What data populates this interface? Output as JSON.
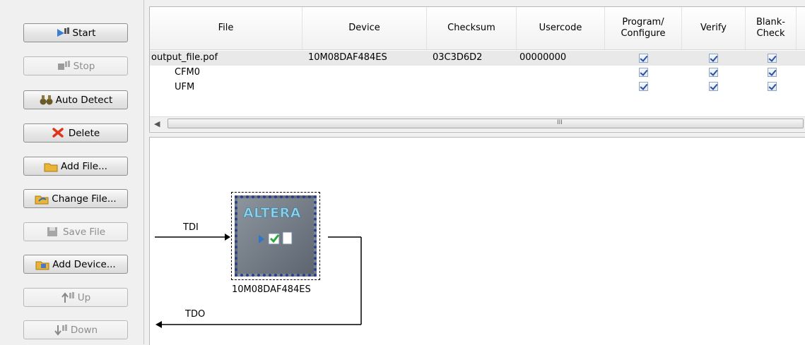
{
  "buttons": {
    "start": "Start",
    "stop": "Stop",
    "auto_detect": "Auto Detect",
    "delete": "Delete",
    "add_file": "Add File...",
    "change_file": "Change File...",
    "save_file": "Save File",
    "add_device": "Add Device...",
    "up": "Up",
    "down": "Down"
  },
  "table": {
    "headers": {
      "file": "File",
      "device": "Device",
      "checksum": "Checksum",
      "usercode": "Usercode",
      "program_line1": "Program/",
      "program_line2": "Configure",
      "verify": "Verify",
      "blank_line1": "Blank-",
      "blank_line2": "Check"
    },
    "rows": [
      {
        "file": "output_file.pof",
        "device": "10M08DAF484ES",
        "checksum": "03C3D6D2",
        "usercode": "00000000",
        "program": true,
        "verify": true,
        "blank_check": true
      },
      {
        "file": "CFM0",
        "device": "",
        "checksum": "",
        "usercode": "",
        "program": true,
        "verify": true,
        "blank_check": true
      },
      {
        "file": "UFM",
        "device": "",
        "checksum": "",
        "usercode": "",
        "program": true,
        "verify": true,
        "blank_check": true
      }
    ],
    "scroll_grip": "III"
  },
  "chain": {
    "tdi": "TDI",
    "tdo": "TDO",
    "device_name": "10M08DAF484ES",
    "logo_text": "ALTERA"
  },
  "colors": {
    "chip_body": "#6f7883",
    "chip_border": "#2a3f8f",
    "logo": "#8fd1ea",
    "delete_icon": "#e0331c"
  }
}
